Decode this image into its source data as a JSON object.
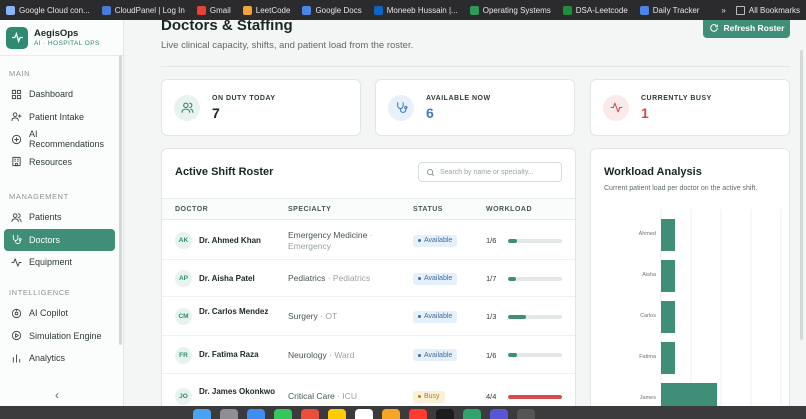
{
  "bookmarks": [
    {
      "label": "Google Cloud con...",
      "color": "#8ab4f8"
    },
    {
      "label": "CloudPanel | Log In",
      "color": "#4a7bd8"
    },
    {
      "label": "Gmail",
      "color": "#e94235"
    },
    {
      "label": "LeetCode",
      "color": "#f0a43a"
    },
    {
      "label": "Google Docs",
      "color": "#4a86e8"
    },
    {
      "label": "Moneeb Hussain |...",
      "color": "#0a66c2"
    },
    {
      "label": "Operating Systems",
      "color": "#2e9a5a"
    },
    {
      "label": "DSA-Leetcode",
      "color": "#1e8e3e"
    },
    {
      "label": "Daily Tracker",
      "color": "#4a86e8"
    }
  ],
  "bookmarks_more": "»",
  "all_bookmarks": "All Bookmarks",
  "brand": {
    "name": "AegisOps",
    "subtitle": "AI · HOSPITAL OPS"
  },
  "sidebar": {
    "sections": [
      {
        "label": "MAIN",
        "items": [
          {
            "label": "Dashboard",
            "icon": "grid-icon"
          },
          {
            "label": "Patient Intake",
            "icon": "user-plus-icon"
          },
          {
            "label": "AI Recommendations",
            "icon": "circle-plus-icon"
          },
          {
            "label": "Resources",
            "icon": "building-icon"
          }
        ]
      },
      {
        "label": "MANAGEMENT",
        "items": [
          {
            "label": "Patients",
            "icon": "users-icon"
          },
          {
            "label": "Doctors",
            "icon": "stethoscope-icon",
            "active": true
          },
          {
            "label": "Equipment",
            "icon": "activity-icon"
          }
        ]
      },
      {
        "label": "INTELLIGENCE",
        "items": [
          {
            "label": "AI Copilot",
            "icon": "bot-icon"
          },
          {
            "label": "Simulation Engine",
            "icon": "play-icon"
          },
          {
            "label": "Analytics",
            "icon": "bar-chart-icon"
          }
        ]
      }
    ],
    "collapse_label": "‹"
  },
  "page": {
    "title": "Doctors & Staffing",
    "subtitle": "Live clinical capacity, shifts, and patient load from the roster.",
    "refresh_label": "Refresh Roster"
  },
  "stats": [
    {
      "label": "ON DUTY TODAY",
      "value": "7",
      "color": "#1b2724",
      "bg": "#e8f2ee",
      "icon_color": "#2f8a72",
      "icon": "users-icon"
    },
    {
      "label": "AVAILABLE NOW",
      "value": "6",
      "color": "#3f7cc4",
      "bg": "#e8f0f9",
      "icon_color": "#3f7cc4",
      "icon": "stethoscope-icon"
    },
    {
      "label": "CURRENTLY BUSY",
      "value": "1",
      "color": "#d64b4b",
      "bg": "#fbeaea",
      "icon_color": "#d64b4b",
      "icon": "activity-icon"
    }
  ],
  "roster": {
    "title": "Active Shift Roster",
    "search_placeholder": "Search by name or specialty...",
    "columns": [
      "DOCTOR",
      "SPECIALTY",
      "STATUS",
      "WORKLOAD"
    ],
    "rows": [
      {
        "initials": "AK",
        "name": "Dr. Ahmed Khan",
        "specialty": "Emergency Medicine",
        "unit": "Emergency",
        "status": "Available",
        "status_type": "avail",
        "load": "1/6",
        "load_fraction": 0.167
      },
      {
        "initials": "AP",
        "name": "Dr. Aisha Patel",
        "specialty": "Pediatrics",
        "unit": "Pediatrics",
        "status": "Available",
        "status_type": "avail",
        "load": "1/7",
        "load_fraction": 0.143
      },
      {
        "initials": "CM",
        "name": "Dr. Carlos Mendez",
        "specialty": "Surgery",
        "unit": "OT",
        "status": "Available",
        "status_type": "avail",
        "load": "1/3",
        "load_fraction": 0.333
      },
      {
        "initials": "FR",
        "name": "Dr. Fatima Raza",
        "specialty": "Neurology",
        "unit": "Ward",
        "status": "Available",
        "status_type": "avail",
        "load": "1/6",
        "load_fraction": 0.167
      },
      {
        "initials": "JO",
        "name": "Dr. James Okonkwo",
        "specialty": "Critical Care",
        "unit": "ICU",
        "status": "Busy",
        "status_type": "busy",
        "load": "4/4",
        "load_fraction": 1.0
      }
    ],
    "bar_color_normal": "#3f8f78",
    "bar_color_full": "#d64b4b"
  },
  "workload": {
    "title": "Workload Analysis",
    "subtitle": "Current patient load per doctor on the active shift.",
    "bar_color": "#3f8f78"
  },
  "chart_data": {
    "type": "bar",
    "orientation": "horizontal",
    "categories": [
      "Ahmed",
      "Aisha",
      "Carlos",
      "Fatima",
      "James"
    ],
    "values": [
      1,
      1,
      1,
      1,
      4
    ],
    "xlim": [
      0,
      4
    ],
    "grid": true
  }
}
